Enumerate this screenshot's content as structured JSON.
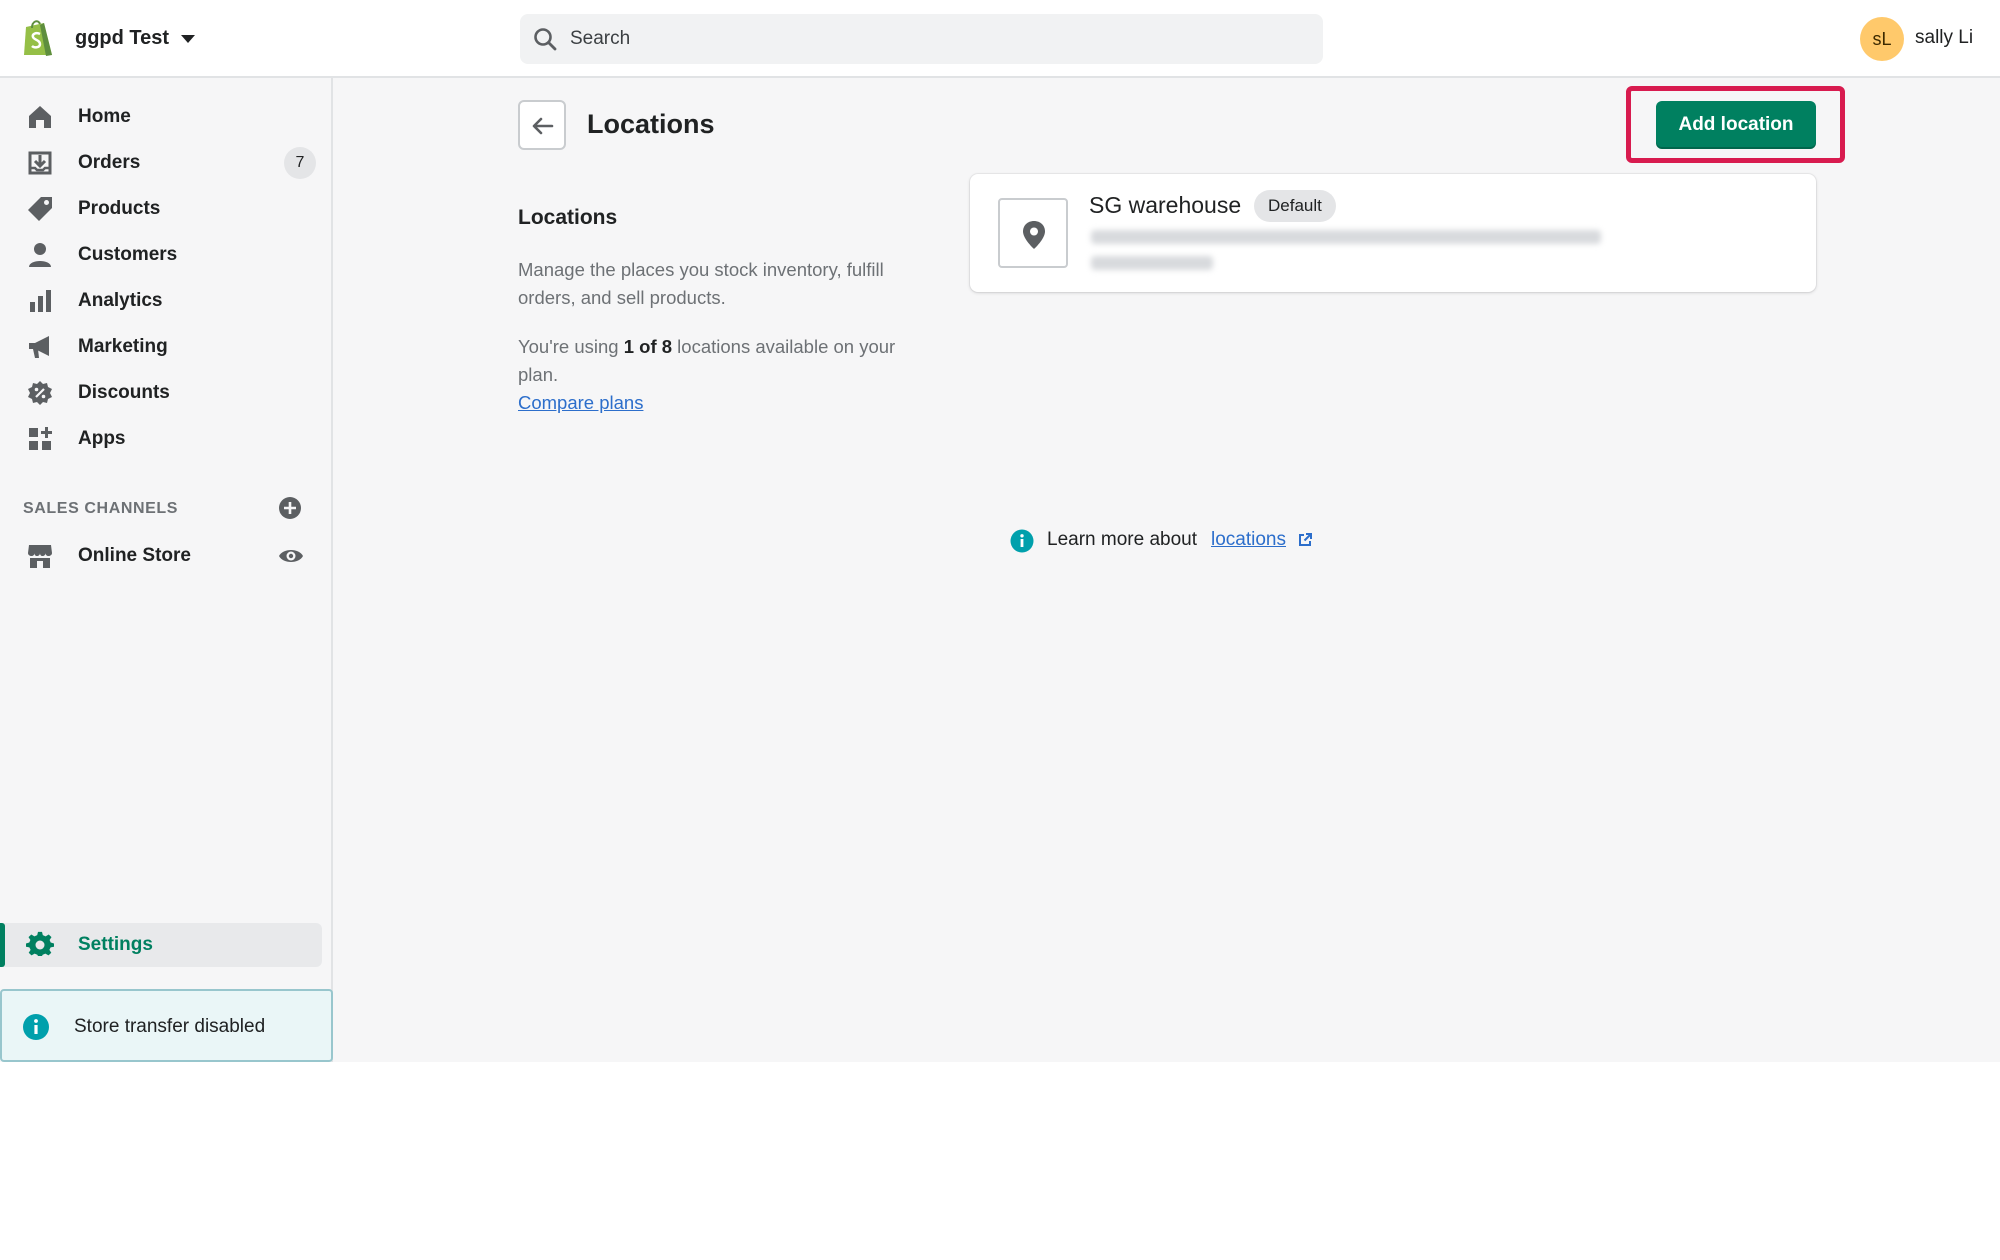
{
  "topbar": {
    "store_name": "ggpd Test",
    "search_placeholder": "Search",
    "user_initials": "sL",
    "user_name": "sally Li"
  },
  "sidebar": {
    "items": [
      {
        "label": "Home",
        "icon": "home-icon"
      },
      {
        "label": "Orders",
        "icon": "orders-icon",
        "badge": "7"
      },
      {
        "label": "Products",
        "icon": "tag-icon"
      },
      {
        "label": "Customers",
        "icon": "person-icon"
      },
      {
        "label": "Analytics",
        "icon": "bar-chart-icon"
      },
      {
        "label": "Marketing",
        "icon": "megaphone-icon"
      },
      {
        "label": "Discounts",
        "icon": "discount-icon"
      },
      {
        "label": "Apps",
        "icon": "apps-icon"
      }
    ],
    "sales_channels_heading": "SALES CHANNELS",
    "online_store": "Online Store",
    "settings": "Settings",
    "store_transfer": "Store transfer disabled"
  },
  "main": {
    "page_title": "Locations",
    "add_location": "Add location",
    "section_title": "Locations",
    "description": "Manage the places you stock inventory, fulfill orders, and sell products.",
    "usage_prefix": "You're using ",
    "usage_bold": "1 of 8",
    "usage_suffix": " locations available on your plan.",
    "compare_plans": "Compare plans",
    "location": {
      "name": "SG warehouse",
      "badge": "Default"
    },
    "learn_more_prefix": "Learn more about",
    "learn_more_link": "locations"
  },
  "colors": {
    "primary": "#008060",
    "highlight": "#d81b4f",
    "link": "#2c6ecb",
    "info": "#00a0ac"
  }
}
